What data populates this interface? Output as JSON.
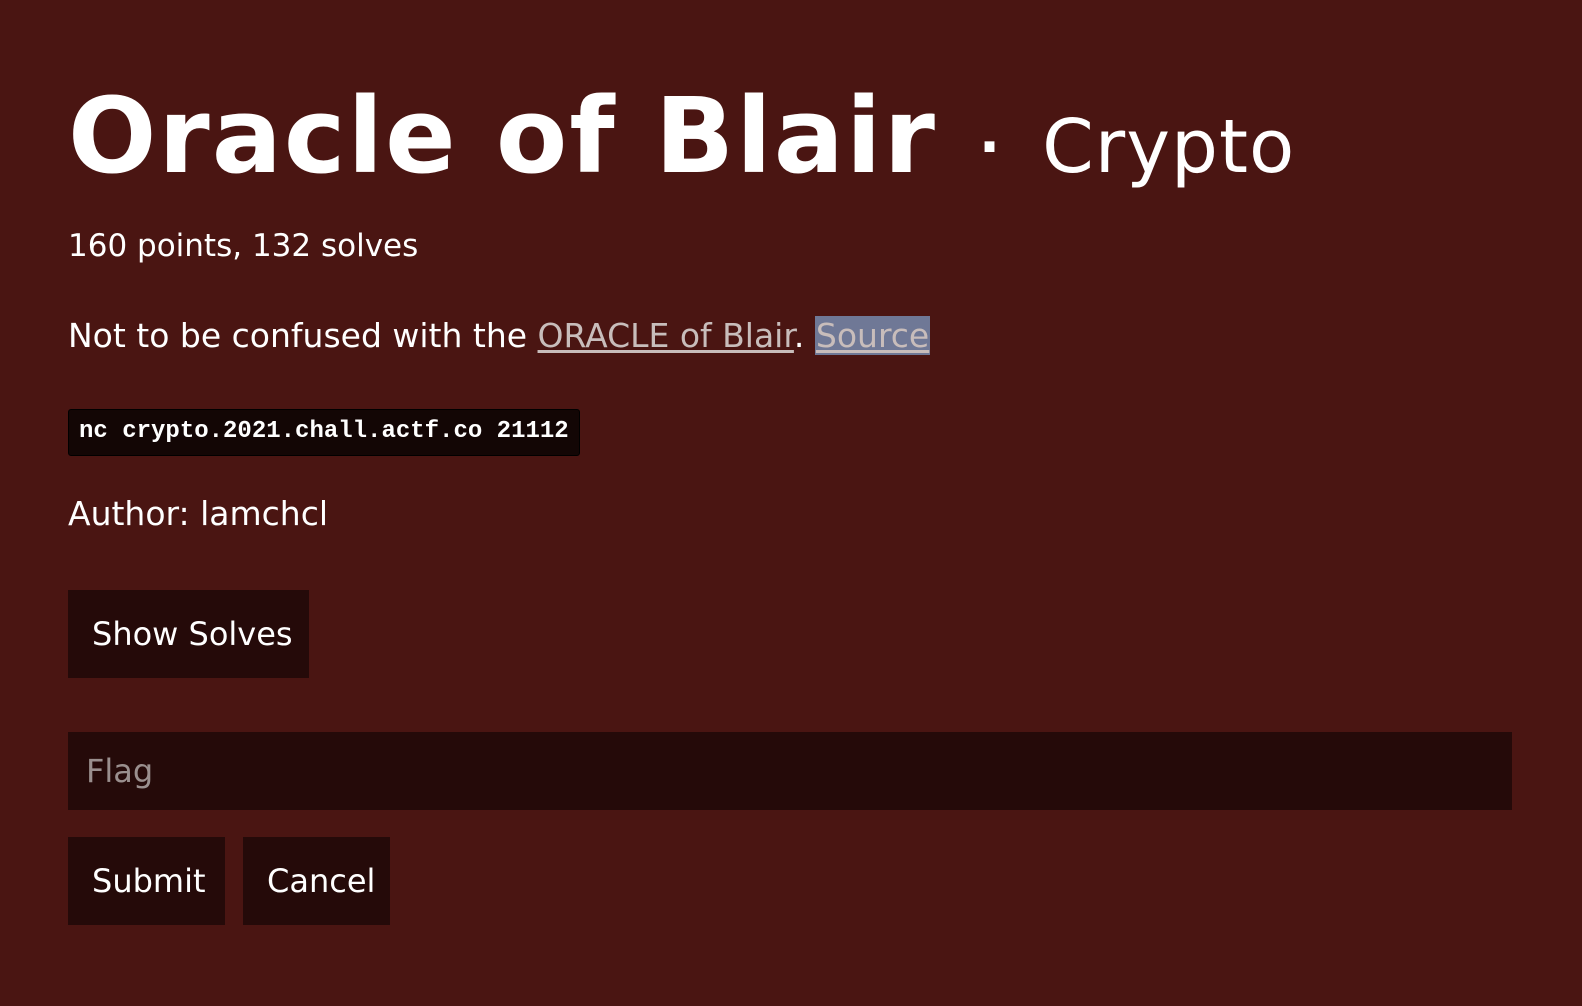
{
  "challenge": {
    "title": "Oracle of Blair",
    "separator": "·",
    "category": "Crypto",
    "stats": "160 points, 132 solves",
    "description": {
      "prefix": "Not to be confused with the ",
      "link_text": "ORACLE of Blair",
      "middle": ". ",
      "source_link": "Source"
    },
    "command": "nc crypto.2021.chall.actf.co 21112",
    "author": "Author: lamchcl"
  },
  "actions": {
    "show_solves_label": "Show Solves",
    "submit_label": "Submit",
    "cancel_label": "Cancel"
  },
  "flag_input": {
    "placeholder": "Flag",
    "value": ""
  },
  "colors": {
    "background": "#4a1512",
    "button_background": "#250a09",
    "link": "#c8bdbb",
    "selection": "#6f7896"
  }
}
